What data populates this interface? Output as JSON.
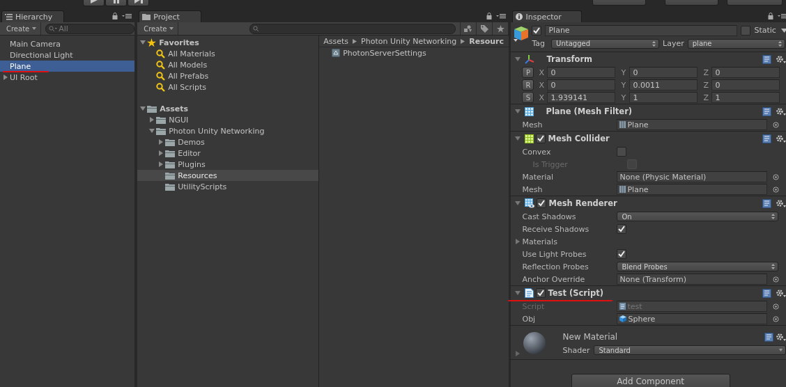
{
  "hierarchy": {
    "tab": "Hierarchy",
    "create": "Create",
    "search": {
      "placeholder": "All"
    },
    "items": [
      {
        "label": "Main Camera",
        "selected": false,
        "annotated": false
      },
      {
        "label": "Directional Light",
        "selected": false,
        "annotated": false
      },
      {
        "label": "Plane",
        "selected": true,
        "annotated": true
      },
      {
        "label": "UI Root",
        "selected": false,
        "annotated": false,
        "expanded": false
      }
    ]
  },
  "project": {
    "tab": "Project",
    "create": "Create",
    "tree": [
      {
        "label": "Favorites",
        "kind": "favorites",
        "expanded": true,
        "selected": false,
        "children": [
          {
            "label": "All Materials",
            "kind": "search",
            "selected": false
          },
          {
            "label": "All Models",
            "kind": "search",
            "selected": false
          },
          {
            "label": "All Prefabs",
            "kind": "search",
            "selected": false
          },
          {
            "label": "All Scripts",
            "kind": "search",
            "selected": false
          }
        ]
      },
      {
        "label": "Assets",
        "kind": "folder",
        "expanded": true,
        "selected": false,
        "children": [
          {
            "label": "NGUI",
            "kind": "folder",
            "expanded": false,
            "selected": false
          },
          {
            "label": "Photon Unity Networking",
            "kind": "folder",
            "expanded": true,
            "selected": false,
            "children": [
              {
                "label": "Demos",
                "kind": "folder",
                "expanded": false,
                "selected": false
              },
              {
                "label": "Editor",
                "kind": "folder",
                "expanded": false,
                "selected": false
              },
              {
                "label": "Plugins",
                "kind": "folder",
                "expanded": false,
                "selected": false
              },
              {
                "label": "Resources",
                "kind": "folder",
                "selected": true
              },
              {
                "label": "UtilityScripts",
                "kind": "folder",
                "selected": false
              }
            ]
          }
        ]
      }
    ],
    "breadcrumb": [
      {
        "label": "Assets",
        "current": false
      },
      {
        "label": "Photon Unity Networking",
        "current": false
      },
      {
        "label": "Resourc",
        "current": true
      }
    ],
    "files": [
      {
        "label": "PhotonServerSettings",
        "selected": false
      }
    ]
  },
  "inspector": {
    "tab": "Inspector",
    "object": {
      "active": true,
      "name": "Plane",
      "static": false,
      "static_label": "Static",
      "tag_label": "Tag",
      "tag": "Untagged",
      "layer_label": "Layer",
      "layer": "plane"
    },
    "components": [
      {
        "kind": "transform",
        "title": "Transform",
        "expanded": true,
        "annotated": false,
        "rows": [
          {
            "kind": "vector3",
            "button": "P",
            "values": [
              {
                "axis": "X",
                "value": "0"
              },
              {
                "axis": "Y",
                "value": "0"
              },
              {
                "axis": "Z",
                "value": "0"
              }
            ]
          },
          {
            "kind": "vector3",
            "button": "R",
            "values": [
              {
                "axis": "X",
                "value": "0"
              },
              {
                "axis": "Y",
                "value": "0.0011"
              },
              {
                "axis": "Z",
                "value": "0"
              }
            ]
          },
          {
            "kind": "vector3",
            "button": "S",
            "values": [
              {
                "axis": "X",
                "value": "1.939141"
              },
              {
                "axis": "Y",
                "value": "1"
              },
              {
                "axis": "Z",
                "value": "1"
              }
            ]
          }
        ]
      },
      {
        "kind": "mesh_filter",
        "title": "Plane (Mesh Filter)",
        "expanded": true,
        "annotated": false,
        "rows": [
          {
            "kind": "object",
            "label": "Mesh",
            "value": "Plane",
            "asset": {
              "kind": "mesh"
            },
            "disabled": false
          }
        ]
      },
      {
        "kind": "mesh_collider",
        "title": "Mesh Collider",
        "enabled": true,
        "expanded": true,
        "annotated": false,
        "rows": [
          {
            "kind": "checkbox",
            "label": "Convex",
            "checked": false,
            "disabled": false,
            "children": [
              {
                "kind": "checkbox",
                "label": "Is Trigger",
                "checked": false,
                "disabled": true
              }
            ]
          },
          {
            "kind": "object",
            "label": "Material",
            "value": "None (Physic Material)",
            "disabled": false
          },
          {
            "kind": "object",
            "label": "Mesh",
            "value": "Plane",
            "asset": {
              "kind": "mesh"
            },
            "disabled": false
          }
        ]
      },
      {
        "kind": "mesh_renderer",
        "title": "Mesh Renderer",
        "enabled": true,
        "expanded": true,
        "annotated": false,
        "rows": [
          {
            "kind": "dropdown",
            "label": "Cast Shadows",
            "value": "On"
          },
          {
            "kind": "checkbox",
            "label": "Receive Shadows",
            "checked": true,
            "disabled": false
          },
          {
            "kind": "foldout",
            "label": "Materials",
            "expanded": false
          },
          {
            "kind": "checkbox",
            "label": "Use Light Probes",
            "checked": true,
            "disabled": false
          },
          {
            "kind": "dropdown",
            "label": "Reflection Probes",
            "value": "Blend Probes"
          },
          {
            "kind": "object",
            "label": "Anchor Override",
            "value": "None (Transform)",
            "disabled": false
          }
        ]
      },
      {
        "kind": "script",
        "title": "Test (Script)",
        "enabled": true,
        "expanded": true,
        "annotated": true,
        "rows": [
          {
            "kind": "object",
            "label": "Script",
            "value": "test",
            "asset": {
              "kind": "script"
            },
            "disabled": true
          },
          {
            "kind": "object",
            "label": "Obj",
            "value": "Sphere",
            "asset": {
              "kind": "prefab"
            },
            "disabled": false
          }
        ]
      }
    ],
    "material": {
      "title": "New Material",
      "expanded": false,
      "shader_label": "Shader",
      "shader": "Standard"
    },
    "add_button": "Add Component"
  }
}
